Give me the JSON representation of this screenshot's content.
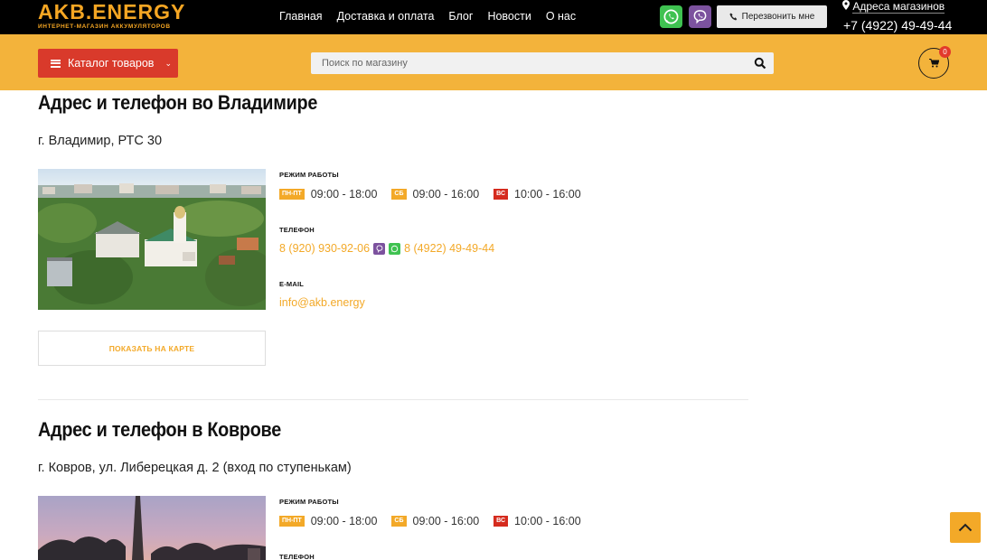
{
  "header": {
    "logo_main": "AKB.ENERGY",
    "logo_sub": "ИНТЕРНЕТ-МАГАЗИН АККУМУЛЯТОРОВ",
    "nav": [
      "Главная",
      "Доставка и оплата",
      "Блог",
      "Новости",
      "О нас"
    ],
    "callback_label": "Перезвонить мне",
    "shops_label": "Адреса магазинов",
    "phone": "+7 (4922) 49-49-44",
    "colors": {
      "topbar": "#000000",
      "brand": "#f5a623"
    }
  },
  "toolbar": {
    "catalog_label": "Каталог товаров",
    "search_placeholder": "Поиск по магазину",
    "cart_count": "0",
    "colors": {
      "bar": "#f3b33b",
      "catalog_button": "#d93a2b"
    }
  },
  "stores": [
    {
      "title": "Адрес и телефон во Владимире",
      "address": "г. Владимир, РТС 30",
      "hours_label": "РЕЖИМ РАБОТЫ",
      "schedule": [
        {
          "day": "ПН-ПТ",
          "hours": "09:00 - 18:00"
        },
        {
          "day": "СБ",
          "hours": "09:00 - 16:00"
        },
        {
          "day": "ВС",
          "hours": "10:00 - 16:00"
        }
      ],
      "phone_label": "ТЕЛЕФОН",
      "phone1": "8 (920) 930-92-06",
      "phone2": "8 (4922) 49-49-44",
      "email_label": "E-MAIL",
      "email": "info@akb.energy",
      "map_button": "ПОКАЗАТЬ НА КАРТЕ"
    },
    {
      "title": "Адрес и телефон в Коврове",
      "address": "г. Ковров, ул. Либерецкая д. 2 (вход по ступенькам)",
      "hours_label": "РЕЖИМ РАБОТЫ",
      "schedule": [
        {
          "day": "ПН-ПТ",
          "hours": "09:00 - 18:00"
        },
        {
          "day": "СБ",
          "hours": "09:00 - 16:00"
        },
        {
          "day": "ВС",
          "hours": "10:00 - 16:00"
        }
      ],
      "phone_label": "ТЕЛЕФОН"
    }
  ],
  "icons": {
    "whatsapp": "whatsapp-icon",
    "viber": "viber-icon",
    "phone": "phone-icon",
    "pin": "map-pin-icon",
    "search": "search-icon",
    "cart": "cart-icon",
    "scroll_top": "chevron-up-icon"
  }
}
